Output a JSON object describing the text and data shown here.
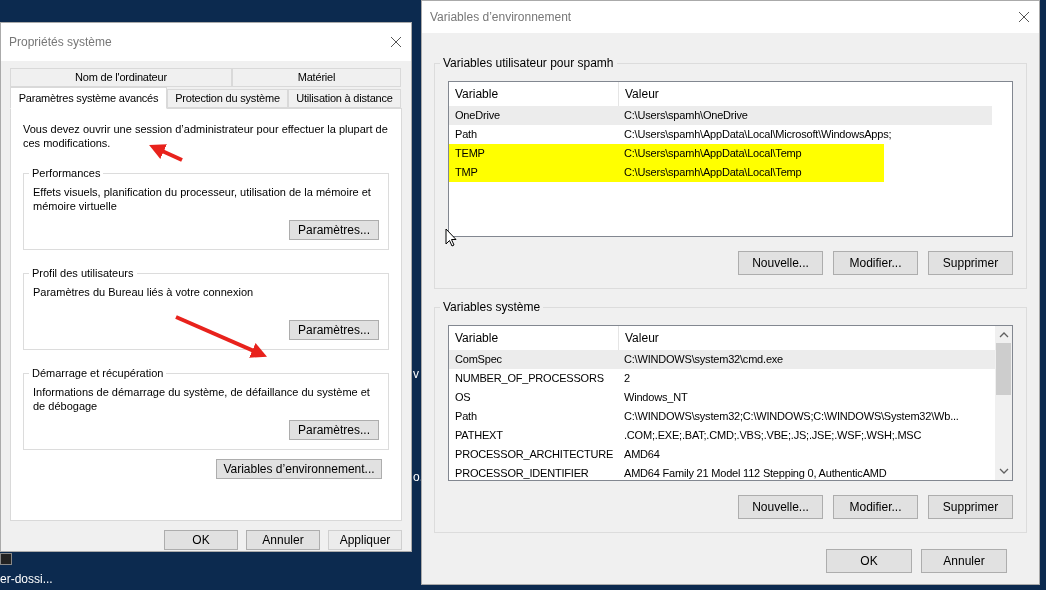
{
  "desktop": {
    "labels": [
      "v",
      "o.",
      "er-dossi..."
    ]
  },
  "system_properties": {
    "title": "Propriétés système",
    "tabs_top": [
      {
        "label": "Nom de l'ordinateur",
        "selected": false
      },
      {
        "label": "Matériel",
        "selected": false
      }
    ],
    "tabs_bottom": [
      {
        "label": "Paramètres système avancés",
        "selected": true
      },
      {
        "label": "Protection du système",
        "selected": false
      },
      {
        "label": "Utilisation à distance",
        "selected": false
      }
    ],
    "notice": "Vous devez ouvrir une session d’administrateur pour effectuer la plupart de ces modifications.",
    "groups": [
      {
        "title": "Performances",
        "description": "Effets visuels, planification du processeur, utilisation de la mémoire et mémoire virtuelle",
        "button": "Paramètres..."
      },
      {
        "title": "Profil des utilisateurs",
        "description": "Paramètres du Bureau liés à votre connexion",
        "button": "Paramètres..."
      },
      {
        "title": "Démarrage et récupération",
        "description": "Informations de démarrage du système, de défaillance du système et de débogage",
        "button": "Paramètres..."
      }
    ],
    "env_button": "Variables d’environnement...",
    "buttons": [
      {
        "label": "OK",
        "disabled": false
      },
      {
        "label": "Annuler",
        "disabled": false
      },
      {
        "label": "Appliquer",
        "disabled": true
      }
    ]
  },
  "environment_variables": {
    "title": "Variables d’environnement",
    "sections": [
      {
        "title": "Variables utilisateur pour spamh",
        "columns": [
          "Variable",
          "Valeur"
        ],
        "scrollbar": false,
        "rows": [
          {
            "variable": "OneDrive",
            "value": "C:\\Users\\spamh\\OneDrive",
            "selected": true,
            "highlighted": false
          },
          {
            "variable": "Path",
            "value": "C:\\Users\\spamh\\AppData\\Local\\Microsoft\\WindowsApps;",
            "selected": false,
            "highlighted": false
          },
          {
            "variable": "TEMP",
            "value": "C:\\Users\\spamh\\AppData\\Local\\Temp",
            "selected": false,
            "highlighted": true
          },
          {
            "variable": "TMP",
            "value": "C:\\Users\\spamh\\AppData\\Local\\Temp",
            "selected": false,
            "highlighted": true
          }
        ],
        "buttons": [
          "Nouvelle...",
          "Modifier...",
          "Supprimer"
        ]
      },
      {
        "title": "Variables système",
        "columns": [
          "Variable",
          "Valeur"
        ],
        "scrollbar": true,
        "rows": [
          {
            "variable": "ComSpec",
            "value": "C:\\WINDOWS\\system32\\cmd.exe",
            "selected": true,
            "highlighted": false
          },
          {
            "variable": "NUMBER_OF_PROCESSORS",
            "value": "2",
            "selected": false,
            "highlighted": false
          },
          {
            "variable": "OS",
            "value": "Windows_NT",
            "selected": false,
            "highlighted": false
          },
          {
            "variable": "Path",
            "value": "C:\\WINDOWS\\system32;C:\\WINDOWS;C:\\WINDOWS\\System32\\Wb...",
            "selected": false,
            "highlighted": false
          },
          {
            "variable": "PATHEXT",
            "value": ".COM;.EXE;.BAT;.CMD;.VBS;.VBE;.JS;.JSE;.WSF;.WSH;.MSC",
            "selected": false,
            "highlighted": false
          },
          {
            "variable": "PROCESSOR_ARCHITECTURE",
            "value": "AMD64",
            "selected": false,
            "highlighted": false
          },
          {
            "variable": "PROCESSOR_IDENTIFIER",
            "value": "AMD64 Family 21 Model 112 Stepping 0, AuthenticAMD",
            "selected": false,
            "highlighted": false
          }
        ],
        "buttons": [
          "Nouvelle...",
          "Modifier...",
          "Supprimer"
        ]
      }
    ],
    "buttons": [
      "OK",
      "Annuler"
    ]
  }
}
